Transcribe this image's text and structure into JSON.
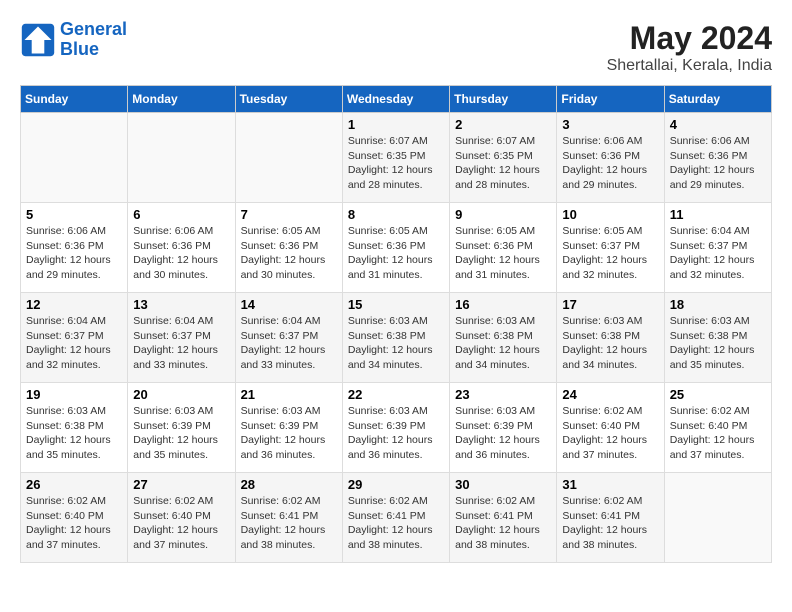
{
  "logo": {
    "line1": "General",
    "line2": "Blue"
  },
  "title": "May 2024",
  "subtitle": "Shertallai, Kerala, India",
  "weekdays": [
    "Sunday",
    "Monday",
    "Tuesday",
    "Wednesday",
    "Thursday",
    "Friday",
    "Saturday"
  ],
  "weeks": [
    [
      {
        "day": "",
        "info": ""
      },
      {
        "day": "",
        "info": ""
      },
      {
        "day": "",
        "info": ""
      },
      {
        "day": "1",
        "info": "Sunrise: 6:07 AM\nSunset: 6:35 PM\nDaylight: 12 hours\nand 28 minutes."
      },
      {
        "day": "2",
        "info": "Sunrise: 6:07 AM\nSunset: 6:35 PM\nDaylight: 12 hours\nand 28 minutes."
      },
      {
        "day": "3",
        "info": "Sunrise: 6:06 AM\nSunset: 6:36 PM\nDaylight: 12 hours\nand 29 minutes."
      },
      {
        "day": "4",
        "info": "Sunrise: 6:06 AM\nSunset: 6:36 PM\nDaylight: 12 hours\nand 29 minutes."
      }
    ],
    [
      {
        "day": "5",
        "info": "Sunrise: 6:06 AM\nSunset: 6:36 PM\nDaylight: 12 hours\nand 29 minutes."
      },
      {
        "day": "6",
        "info": "Sunrise: 6:06 AM\nSunset: 6:36 PM\nDaylight: 12 hours\nand 30 minutes."
      },
      {
        "day": "7",
        "info": "Sunrise: 6:05 AM\nSunset: 6:36 PM\nDaylight: 12 hours\nand 30 minutes."
      },
      {
        "day": "8",
        "info": "Sunrise: 6:05 AM\nSunset: 6:36 PM\nDaylight: 12 hours\nand 31 minutes."
      },
      {
        "day": "9",
        "info": "Sunrise: 6:05 AM\nSunset: 6:36 PM\nDaylight: 12 hours\nand 31 minutes."
      },
      {
        "day": "10",
        "info": "Sunrise: 6:05 AM\nSunset: 6:37 PM\nDaylight: 12 hours\nand 32 minutes."
      },
      {
        "day": "11",
        "info": "Sunrise: 6:04 AM\nSunset: 6:37 PM\nDaylight: 12 hours\nand 32 minutes."
      }
    ],
    [
      {
        "day": "12",
        "info": "Sunrise: 6:04 AM\nSunset: 6:37 PM\nDaylight: 12 hours\nand 32 minutes."
      },
      {
        "day": "13",
        "info": "Sunrise: 6:04 AM\nSunset: 6:37 PM\nDaylight: 12 hours\nand 33 minutes."
      },
      {
        "day": "14",
        "info": "Sunrise: 6:04 AM\nSunset: 6:37 PM\nDaylight: 12 hours\nand 33 minutes."
      },
      {
        "day": "15",
        "info": "Sunrise: 6:03 AM\nSunset: 6:38 PM\nDaylight: 12 hours\nand 34 minutes."
      },
      {
        "day": "16",
        "info": "Sunrise: 6:03 AM\nSunset: 6:38 PM\nDaylight: 12 hours\nand 34 minutes."
      },
      {
        "day": "17",
        "info": "Sunrise: 6:03 AM\nSunset: 6:38 PM\nDaylight: 12 hours\nand 34 minutes."
      },
      {
        "day": "18",
        "info": "Sunrise: 6:03 AM\nSunset: 6:38 PM\nDaylight: 12 hours\nand 35 minutes."
      }
    ],
    [
      {
        "day": "19",
        "info": "Sunrise: 6:03 AM\nSunset: 6:38 PM\nDaylight: 12 hours\nand 35 minutes."
      },
      {
        "day": "20",
        "info": "Sunrise: 6:03 AM\nSunset: 6:39 PM\nDaylight: 12 hours\nand 35 minutes."
      },
      {
        "day": "21",
        "info": "Sunrise: 6:03 AM\nSunset: 6:39 PM\nDaylight: 12 hours\nand 36 minutes."
      },
      {
        "day": "22",
        "info": "Sunrise: 6:03 AM\nSunset: 6:39 PM\nDaylight: 12 hours\nand 36 minutes."
      },
      {
        "day": "23",
        "info": "Sunrise: 6:03 AM\nSunset: 6:39 PM\nDaylight: 12 hours\nand 36 minutes."
      },
      {
        "day": "24",
        "info": "Sunrise: 6:02 AM\nSunset: 6:40 PM\nDaylight: 12 hours\nand 37 minutes."
      },
      {
        "day": "25",
        "info": "Sunrise: 6:02 AM\nSunset: 6:40 PM\nDaylight: 12 hours\nand 37 minutes."
      }
    ],
    [
      {
        "day": "26",
        "info": "Sunrise: 6:02 AM\nSunset: 6:40 PM\nDaylight: 12 hours\nand 37 minutes."
      },
      {
        "day": "27",
        "info": "Sunrise: 6:02 AM\nSunset: 6:40 PM\nDaylight: 12 hours\nand 37 minutes."
      },
      {
        "day": "28",
        "info": "Sunrise: 6:02 AM\nSunset: 6:41 PM\nDaylight: 12 hours\nand 38 minutes."
      },
      {
        "day": "29",
        "info": "Sunrise: 6:02 AM\nSunset: 6:41 PM\nDaylight: 12 hours\nand 38 minutes."
      },
      {
        "day": "30",
        "info": "Sunrise: 6:02 AM\nSunset: 6:41 PM\nDaylight: 12 hours\nand 38 minutes."
      },
      {
        "day": "31",
        "info": "Sunrise: 6:02 AM\nSunset: 6:41 PM\nDaylight: 12 hours\nand 38 minutes."
      },
      {
        "day": "",
        "info": ""
      }
    ]
  ]
}
